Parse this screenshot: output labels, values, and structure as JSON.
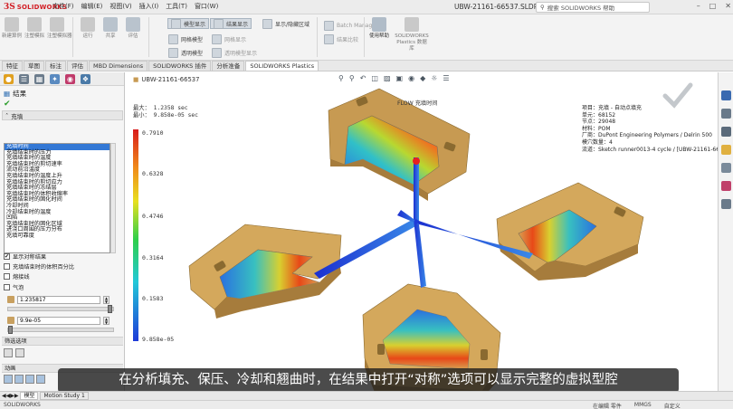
{
  "app": {
    "brand_ds": "3S",
    "brand_name": "SOLIDWORKS",
    "title": "UBW-21161-66537.SLDPRT *",
    "search_placeholder": "搜索 SOLIDWORKS 帮助",
    "menu": [
      "文件(F)",
      "编辑(E)",
      "视图(V)",
      "插入(I)",
      "工具(T)",
      "窗口(W)"
    ]
  },
  "ribbon": {
    "groups": [
      {
        "label": "新建算例"
      },
      {
        "label": "注塑模拟"
      },
      {
        "label": "注塑模拟器"
      },
      {
        "label": "运行"
      },
      {
        "label": "共享"
      },
      {
        "label": "评估"
      }
    ],
    "rows": {
      "model_display": "模型显示",
      "result_display": "结果显示",
      "show_fill_region": "显示/隐藏区域",
      "mesh_model": "网格模型",
      "mesh_display": "网格显示",
      "transparent_model": "透明模型",
      "transparent_display": "透明模型显示",
      "batch_manager": "Batch Manager",
      "results_compare": "结果比较",
      "help_label": "使用帮助",
      "library_label": "SOLIDWORKS Plastics 数据库"
    }
  },
  "tabs": [
    {
      "label": "特征",
      "active": false
    },
    {
      "label": "草图",
      "active": false
    },
    {
      "label": "标注",
      "active": false
    },
    {
      "label": "评估",
      "active": false
    },
    {
      "label": "MBD Dimensions",
      "active": false
    },
    {
      "label": "SOLIDWORKS 插件",
      "active": false
    },
    {
      "label": "分析准备",
      "active": false
    },
    {
      "label": "SOLIDWORKS Plastics",
      "active": true
    }
  ],
  "panel": {
    "title": "结果",
    "section_fill": "充填",
    "results": [
      "充填时间",
      "充填结束时的压力",
      "充填结束时的温度",
      "充填结束时的剪切速率",
      "流动前沿温度",
      "充填结束时的温度上升",
      "充填结束时的剪切应力",
      "充填结束时的冻结层",
      "充填结束时的体积收缩率",
      "充填结束时的固化时间",
      "冷却时间",
      "冷却结束时的温度",
      "凹陷",
      "充填结束时的固化区域",
      "进浇口周围的压力分布",
      "充填可靠度"
    ],
    "selected_index": 0,
    "checks": [
      {
        "label": "显示对称结果",
        "checked": true
      },
      {
        "label": "充填结束时的体积百分比",
        "checked": false
      },
      {
        "label": "熔接线",
        "checked": false
      },
      {
        "label": "气泡",
        "checked": false
      }
    ],
    "max_value": "1.235817",
    "min_value": "9.9e-05",
    "max_slider": 0.98,
    "min_slider": 0.0,
    "filter_label": "筛选选项",
    "animation_label": "动画"
  },
  "viewport": {
    "part_name": "UBW-21161-66537",
    "max_label": "最大：  1.2358  sec",
    "min_label": "最小：  9.858e-05  sec",
    "flow_label": "FLOW 充填时间",
    "legend_ticks": [
      "0.7910",
      "0.6328",
      "0.4746",
      "0.3164",
      "0.1583",
      "9.858e-05"
    ],
    "info": [
      "项目：充填 - 自动点填充",
      "单元：68152",
      "节点：29048",
      "材料：POM",
      "厂商：DuPont Engineering Polymers / Delrin 500",
      "模穴数量：4",
      "流道：Sketch runner0013-4 cycle / [UBW-21161-66537]"
    ]
  },
  "bottom_tabs": [
    {
      "label": "模型",
      "active": true
    },
    {
      "label": "Motion Study 1",
      "active": false
    }
  ],
  "status": {
    "left": "SOLIDWORKS",
    "right": [
      "在编辑 零件",
      "MMGS",
      "自定义"
    ]
  },
  "caption": "在分析填充、保压、冷却和翘曲时，在结果中打开“对称”选项可以显示完整的虚拟型腔"
}
